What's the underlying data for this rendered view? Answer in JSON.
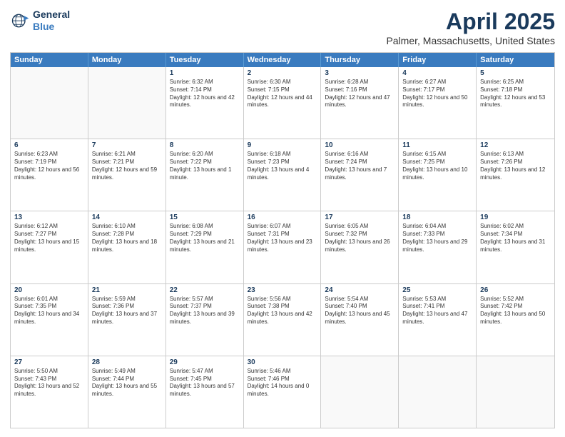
{
  "logo": {
    "line1": "General",
    "line2": "Blue"
  },
  "title": "April 2025",
  "location": "Palmer, Massachusetts, United States",
  "header_days": [
    "Sunday",
    "Monday",
    "Tuesday",
    "Wednesday",
    "Thursday",
    "Friday",
    "Saturday"
  ],
  "weeks": [
    [
      {
        "day": "",
        "text": ""
      },
      {
        "day": "",
        "text": ""
      },
      {
        "day": "1",
        "text": "Sunrise: 6:32 AM\nSunset: 7:14 PM\nDaylight: 12 hours and 42 minutes."
      },
      {
        "day": "2",
        "text": "Sunrise: 6:30 AM\nSunset: 7:15 PM\nDaylight: 12 hours and 44 minutes."
      },
      {
        "day": "3",
        "text": "Sunrise: 6:28 AM\nSunset: 7:16 PM\nDaylight: 12 hours and 47 minutes."
      },
      {
        "day": "4",
        "text": "Sunrise: 6:27 AM\nSunset: 7:17 PM\nDaylight: 12 hours and 50 minutes."
      },
      {
        "day": "5",
        "text": "Sunrise: 6:25 AM\nSunset: 7:18 PM\nDaylight: 12 hours and 53 minutes."
      }
    ],
    [
      {
        "day": "6",
        "text": "Sunrise: 6:23 AM\nSunset: 7:19 PM\nDaylight: 12 hours and 56 minutes."
      },
      {
        "day": "7",
        "text": "Sunrise: 6:21 AM\nSunset: 7:21 PM\nDaylight: 12 hours and 59 minutes."
      },
      {
        "day": "8",
        "text": "Sunrise: 6:20 AM\nSunset: 7:22 PM\nDaylight: 13 hours and 1 minute."
      },
      {
        "day": "9",
        "text": "Sunrise: 6:18 AM\nSunset: 7:23 PM\nDaylight: 13 hours and 4 minutes."
      },
      {
        "day": "10",
        "text": "Sunrise: 6:16 AM\nSunset: 7:24 PM\nDaylight: 13 hours and 7 minutes."
      },
      {
        "day": "11",
        "text": "Sunrise: 6:15 AM\nSunset: 7:25 PM\nDaylight: 13 hours and 10 minutes."
      },
      {
        "day": "12",
        "text": "Sunrise: 6:13 AM\nSunset: 7:26 PM\nDaylight: 13 hours and 12 minutes."
      }
    ],
    [
      {
        "day": "13",
        "text": "Sunrise: 6:12 AM\nSunset: 7:27 PM\nDaylight: 13 hours and 15 minutes."
      },
      {
        "day": "14",
        "text": "Sunrise: 6:10 AM\nSunset: 7:28 PM\nDaylight: 13 hours and 18 minutes."
      },
      {
        "day": "15",
        "text": "Sunrise: 6:08 AM\nSunset: 7:29 PM\nDaylight: 13 hours and 21 minutes."
      },
      {
        "day": "16",
        "text": "Sunrise: 6:07 AM\nSunset: 7:31 PM\nDaylight: 13 hours and 23 minutes."
      },
      {
        "day": "17",
        "text": "Sunrise: 6:05 AM\nSunset: 7:32 PM\nDaylight: 13 hours and 26 minutes."
      },
      {
        "day": "18",
        "text": "Sunrise: 6:04 AM\nSunset: 7:33 PM\nDaylight: 13 hours and 29 minutes."
      },
      {
        "day": "19",
        "text": "Sunrise: 6:02 AM\nSunset: 7:34 PM\nDaylight: 13 hours and 31 minutes."
      }
    ],
    [
      {
        "day": "20",
        "text": "Sunrise: 6:01 AM\nSunset: 7:35 PM\nDaylight: 13 hours and 34 minutes."
      },
      {
        "day": "21",
        "text": "Sunrise: 5:59 AM\nSunset: 7:36 PM\nDaylight: 13 hours and 37 minutes."
      },
      {
        "day": "22",
        "text": "Sunrise: 5:57 AM\nSunset: 7:37 PM\nDaylight: 13 hours and 39 minutes."
      },
      {
        "day": "23",
        "text": "Sunrise: 5:56 AM\nSunset: 7:38 PM\nDaylight: 13 hours and 42 minutes."
      },
      {
        "day": "24",
        "text": "Sunrise: 5:54 AM\nSunset: 7:40 PM\nDaylight: 13 hours and 45 minutes."
      },
      {
        "day": "25",
        "text": "Sunrise: 5:53 AM\nSunset: 7:41 PM\nDaylight: 13 hours and 47 minutes."
      },
      {
        "day": "26",
        "text": "Sunrise: 5:52 AM\nSunset: 7:42 PM\nDaylight: 13 hours and 50 minutes."
      }
    ],
    [
      {
        "day": "27",
        "text": "Sunrise: 5:50 AM\nSunset: 7:43 PM\nDaylight: 13 hours and 52 minutes."
      },
      {
        "day": "28",
        "text": "Sunrise: 5:49 AM\nSunset: 7:44 PM\nDaylight: 13 hours and 55 minutes."
      },
      {
        "day": "29",
        "text": "Sunrise: 5:47 AM\nSunset: 7:45 PM\nDaylight: 13 hours and 57 minutes."
      },
      {
        "day": "30",
        "text": "Sunrise: 5:46 AM\nSunset: 7:46 PM\nDaylight: 14 hours and 0 minutes."
      },
      {
        "day": "",
        "text": ""
      },
      {
        "day": "",
        "text": ""
      },
      {
        "day": "",
        "text": ""
      }
    ]
  ]
}
